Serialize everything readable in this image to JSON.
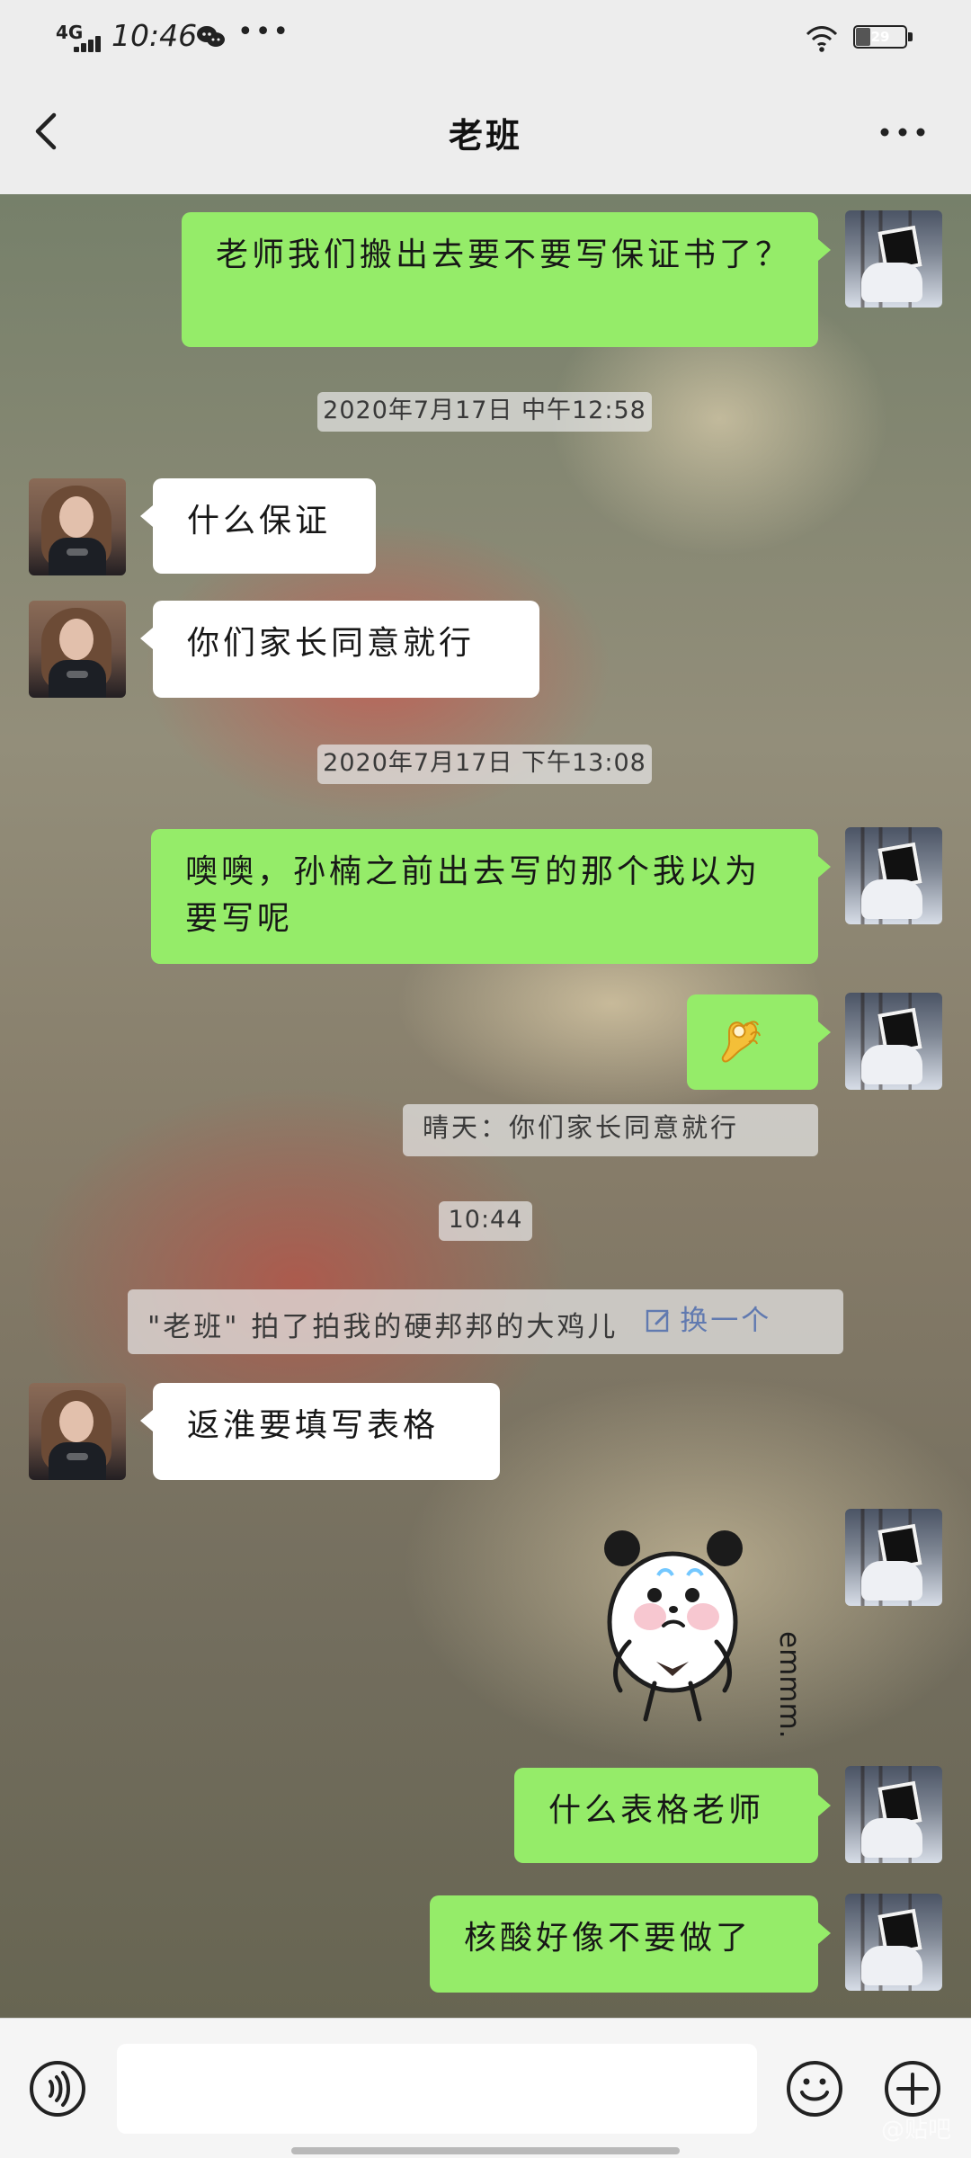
{
  "status_bar": {
    "network_label": "4G",
    "time": "10:46",
    "more": "•••",
    "battery_text": "29",
    "battery_level": 0.29,
    "icons": {
      "wechat": "wechat-icon",
      "wifi": "wifi-icon",
      "battery": "battery-icon"
    }
  },
  "header": {
    "back_icon": "chevron-left-icon",
    "title": "老班",
    "more_icon": "more-horizontal-icon"
  },
  "chat": {
    "messages": {
      "m1": {
        "side": "outgoing",
        "text": "老师我们搬出去要不要写保证书了？"
      },
      "t1": {
        "text": "2020年7月17日 中午12:58"
      },
      "m2": {
        "side": "incoming",
        "text": "什么保证"
      },
      "m3": {
        "side": "incoming",
        "text": "你们家长同意就行"
      },
      "t2": {
        "text": "2020年7月17日 下午13:08"
      },
      "m4": {
        "side": "outgoing",
        "text": "噢噢，孙楠之前出去写的那个我以为要写呢"
      },
      "m5": {
        "side": "outgoing",
        "emoji": "ok-hand-emoji"
      },
      "q1": {
        "text": "晴天：你们家长同意就行"
      },
      "t3": {
        "text": "10:44"
      },
      "s1": {
        "text": "\"老班\" 拍了拍我的硬邦邦的大鸡儿",
        "action": "换一个",
        "icon": "edit-icon"
      },
      "m6": {
        "side": "incoming",
        "text": "返淮要填写表格"
      },
      "m7": {
        "side": "outgoing",
        "sticker": "panda-sticker",
        "sticker_text": "emmm..."
      },
      "m8": {
        "side": "outgoing",
        "text": "什么表格老师"
      },
      "m9": {
        "side": "outgoing",
        "text": "核酸好像不要做了"
      }
    },
    "avatars": {
      "self": "self-avatar",
      "peer": "peer-avatar"
    }
  },
  "input_bar": {
    "voice_icon": "voice-icon",
    "input_placeholder": "",
    "emoji_icon": "emoji-icon",
    "add_icon": "plus-icon"
  },
  "watermark": {
    "text": "@贴吧"
  },
  "colors": {
    "outgoing_bubble": "#95ec69",
    "incoming_bubble": "#ffffff",
    "header_bg": "#ededed",
    "link": "#617ab0"
  }
}
